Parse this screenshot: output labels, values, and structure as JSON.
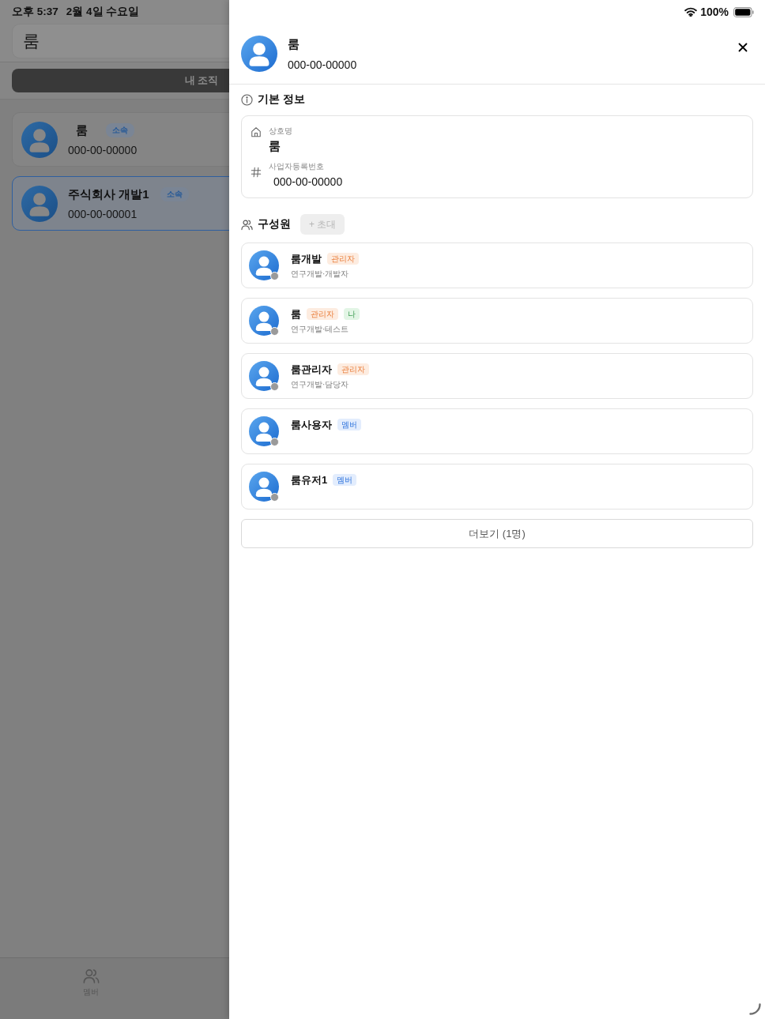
{
  "status_bar": {
    "time": "오후 5:37",
    "date": "2월 4일 수요일",
    "battery": "100%"
  },
  "background": {
    "title_bar": {
      "title": "룸"
    },
    "segments": [
      {
        "label": "내 조직",
        "selected": true
      }
    ],
    "orgs": [
      {
        "name": "룸",
        "badge": "소속",
        "number": "000-00-00000",
        "selected": false
      },
      {
        "name": "주식회사 개발1",
        "badge": "소속",
        "number": "000-00-00001",
        "selected": true
      }
    ],
    "tabs": [
      {
        "label": "멤버",
        "selected": false
      }
    ]
  },
  "sheet": {
    "header": {
      "name": "룸",
      "number": "000-00-00000"
    },
    "basic_info": {
      "title": "기본 정보",
      "fields": [
        {
          "kind": "name",
          "label": "상호명",
          "value": "룸"
        },
        {
          "kind": "number",
          "label": "사업자등록번호",
          "value": "000-00-00000"
        }
      ]
    },
    "members": {
      "title": "구성원",
      "invite": {
        "label": "+ 초대",
        "disabled": true
      },
      "items": [
        {
          "name": "룸개발",
          "tags": [
            {
              "kind": "admin",
              "label": "관리자"
            }
          ],
          "subtitle": "연구개발·개발자",
          "online": false
        },
        {
          "name": "룸",
          "tags": [
            {
              "kind": "admin",
              "label": "관리자"
            },
            {
              "kind": "me",
              "label": "나"
            }
          ],
          "subtitle": "연구개발·테스트",
          "online": false
        },
        {
          "name": "룸관리자",
          "tags": [
            {
              "kind": "admin",
              "label": "관리자"
            }
          ],
          "subtitle": "연구개발·담당자",
          "online": false
        },
        {
          "name": "룸사용자",
          "tags": [
            {
              "kind": "member",
              "label": "멤버"
            }
          ],
          "online": false
        },
        {
          "name": "룸유저1",
          "tags": [
            {
              "kind": "member",
              "label": "멤버"
            }
          ],
          "online": false
        }
      ],
      "more": "더보기 (1명)"
    }
  }
}
